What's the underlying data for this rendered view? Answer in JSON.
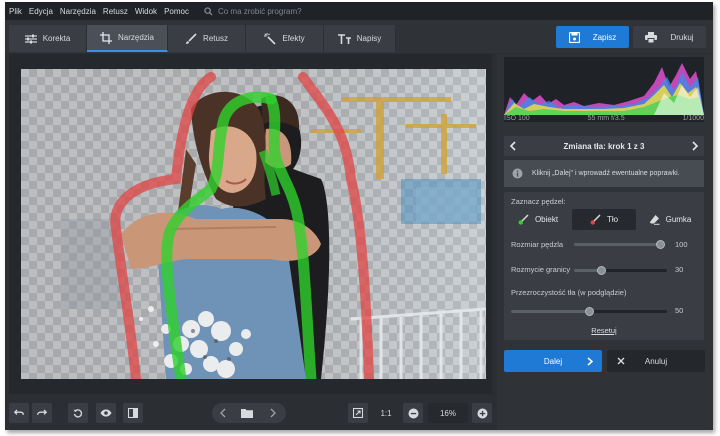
{
  "menu": [
    "Plik",
    "Edycja",
    "Narzędzia",
    "Retusz",
    "Widok",
    "Pomoc"
  ],
  "search": {
    "placeholder": "Co ma zrobić program?"
  },
  "tabs": [
    {
      "label": "Korekta",
      "icon": "sliders-icon"
    },
    {
      "label": "Narzędzia",
      "icon": "crop-icon",
      "active": true
    },
    {
      "label": "Retusz",
      "icon": "brush-icon"
    },
    {
      "label": "Efekty",
      "icon": "magic-wand-icon"
    },
    {
      "label": "Napisy",
      "icon": "text-icon"
    }
  ],
  "actions": {
    "save": "Zapisz",
    "print": "Drukuj"
  },
  "camera": {
    "iso": "ISO 100",
    "lens": "55 mm f/3.5",
    "shutter": "1/1000"
  },
  "step": {
    "title": "Zmiana tła: krok 1 z 3"
  },
  "info": {
    "text": "Kliknij „Dalej\" i wprowadź ewentualne poprawki."
  },
  "brush": {
    "label": "Zaznacz pędzel:",
    "object": "Obiekt",
    "background": "Tło",
    "eraser": "Gumka",
    "selected": "Tło",
    "size": {
      "label": "Rozmiar pędzla",
      "value": "100",
      "fraction": 1.0
    },
    "blur": {
      "label": "Rozmycie granicy",
      "value": "30",
      "fraction": 0.3
    },
    "opacity": {
      "label": "Przezroczystość tła (w podglądzie)",
      "value": "50",
      "fraction": 0.5
    },
    "reset": "Resetuj"
  },
  "footer": {
    "next": "Dalej",
    "cancel": "Anuluj"
  },
  "bottom": {
    "zoom_reset": "1:1",
    "zoom": "16%"
  },
  "colors": {
    "accent": "#1f7ad6",
    "object_stroke": "#2fd12c",
    "background_stroke": "#e04444"
  }
}
